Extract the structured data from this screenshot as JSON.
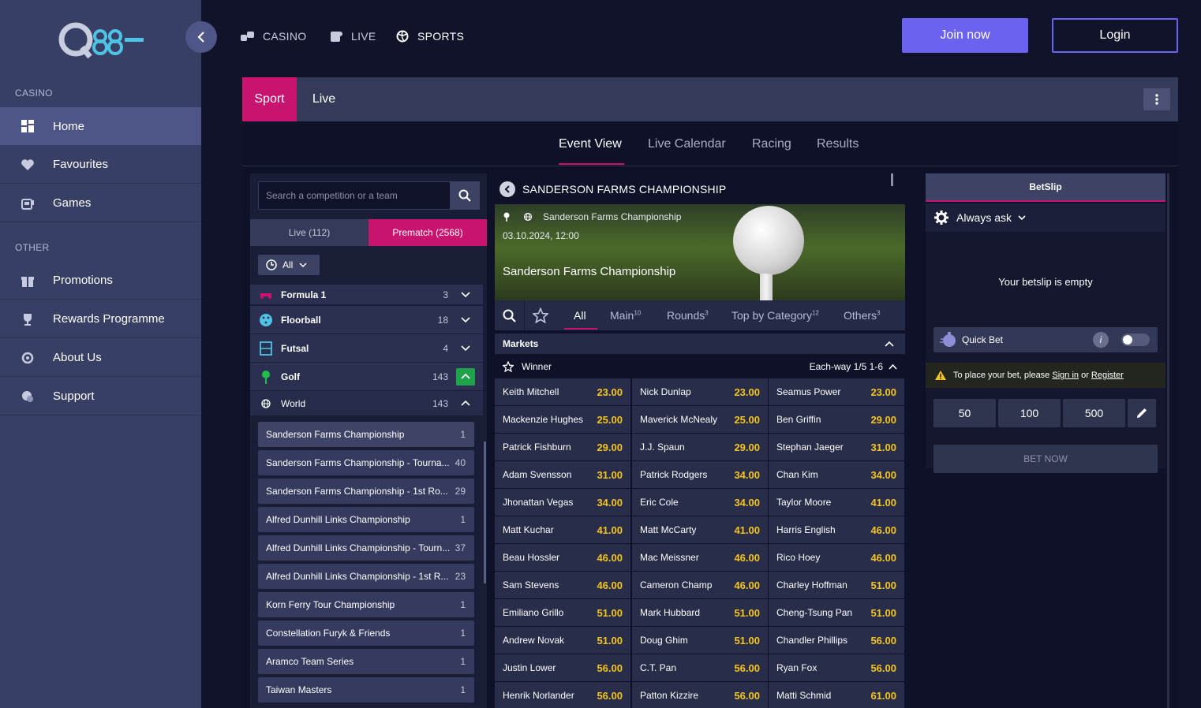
{
  "sidebar": {
    "section_casino": "CASINO",
    "section_other": "OTHER",
    "items": [
      {
        "label": "Home",
        "icon": "grid-icon"
      },
      {
        "label": "Favourites",
        "icon": "heart-icon"
      },
      {
        "label": "Games",
        "icon": "slot-machine-icon"
      },
      {
        "label": "Promotions",
        "icon": "gift-icon"
      },
      {
        "label": "Rewards Programme",
        "icon": "trophy-icon"
      },
      {
        "label": "About Us",
        "icon": "info-circle-icon"
      },
      {
        "label": "Support",
        "icon": "chat-icon"
      }
    ]
  },
  "topnav": {
    "casino": "CASINO",
    "live": "LIVE",
    "sports": "SPORTS"
  },
  "auth": {
    "join": "Join now",
    "login": "Login"
  },
  "modes": {
    "sport": "Sport",
    "live": "Live"
  },
  "view_tabs": [
    "Event View",
    "Live Calendar",
    "Racing",
    "Results"
  ],
  "left_panel": {
    "search_placeholder": "Search a competition or a team",
    "live_tab": "Live (112)",
    "prematch_tab": "Prematch (2568)",
    "filter": "All",
    "sports": [
      {
        "name": "Formula 1",
        "count": "3"
      },
      {
        "name": "Floorball",
        "count": "18"
      },
      {
        "name": "Futsal",
        "count": "4"
      },
      {
        "name": "Golf",
        "count": "143"
      }
    ],
    "region": {
      "name": "World",
      "count": "143"
    },
    "competitions": [
      {
        "name": "Sanderson Farms Championship",
        "count": "1"
      },
      {
        "name": "Sanderson Farms Championship - Tourna...",
        "count": "40"
      },
      {
        "name": "Sanderson Farms Championship - 1st Ro...",
        "count": "29"
      },
      {
        "name": "Alfred Dunhill Links Championship",
        "count": "1"
      },
      {
        "name": "Alfred Dunhill Links Championship - Tourn...",
        "count": "37"
      },
      {
        "name": "Alfred Dunhill Links Championship - 1st R...",
        "count": "23"
      },
      {
        "name": "Korn Ferry Tour Championship",
        "count": "1"
      },
      {
        "name": "Constellation Furyk & Friends",
        "count": "1"
      },
      {
        "name": "Aramco Team Series",
        "count": "1"
      },
      {
        "name": "Taiwan Masters",
        "count": "1"
      }
    ]
  },
  "event": {
    "title": "SANDERSON FARMS CHAMPIONSHIP",
    "league": "Sanderson Farms Championship",
    "datetime": "03.10.2024, 12:00",
    "name": "Sanderson Farms Championship",
    "market_tabs": [
      {
        "label": "All",
        "count": ""
      },
      {
        "label": "Main",
        "count": "10"
      },
      {
        "label": "Rounds",
        "count": "3"
      },
      {
        "label": "Top by Category",
        "count": "12"
      },
      {
        "label": "Others",
        "count": "3"
      }
    ],
    "markets_label": "Markets",
    "winner_label": "Winner",
    "eachway_label": "Each-way 1/5 1-6",
    "odds": [
      [
        "Keith Mitchell",
        "23.00",
        "Nick Dunlap",
        "23.00",
        "Seamus Power",
        "23.00"
      ],
      [
        "Mackenzie Hughes",
        "25.00",
        "Maverick McNealy",
        "25.00",
        "Ben Griffin",
        "29.00"
      ],
      [
        "Patrick Fishburn",
        "29.00",
        "J.J. Spaun",
        "29.00",
        "Stephan Jaeger",
        "31.00"
      ],
      [
        "Adam Svensson",
        "31.00",
        "Patrick Rodgers",
        "34.00",
        "Chan Kim",
        "34.00"
      ],
      [
        "Jhonattan Vegas",
        "34.00",
        "Eric Cole",
        "34.00",
        "Taylor Moore",
        "41.00"
      ],
      [
        "Matt Kuchar",
        "41.00",
        "Matt McCarty",
        "41.00",
        "Harris English",
        "46.00"
      ],
      [
        "Beau Hossler",
        "46.00",
        "Mac Meissner",
        "46.00",
        "Rico Hoey",
        "46.00"
      ],
      [
        "Sam Stevens",
        "46.00",
        "Cameron Champ",
        "46.00",
        "Charley Hoffman",
        "51.00"
      ],
      [
        "Emiliano Grillo",
        "51.00",
        "Mark Hubbard",
        "51.00",
        "Cheng-Tsung Pan",
        "51.00"
      ],
      [
        "Andrew Novak",
        "51.00",
        "Doug Ghim",
        "51.00",
        "Chandler Phillips",
        "56.00"
      ],
      [
        "Justin Lower",
        "56.00",
        "C.T. Pan",
        "56.00",
        "Ryan Fox",
        "56.00"
      ],
      [
        "Henrik Norlander",
        "56.00",
        "Patton Kizzire",
        "56.00",
        "Matti Schmid",
        "61.00"
      ]
    ]
  },
  "betslip": {
    "tab": "BetSlip",
    "ask": "Always ask",
    "empty": "Your betslip is empty",
    "quick_bet": "Quick Bet",
    "warn_pre": "To place your bet, please",
    "sign_in": "Sign in",
    "or": "or",
    "register": "Register",
    "stakes": [
      "50",
      "100",
      "500"
    ],
    "bet_now": "BET NOW"
  },
  "colors": {
    "accent": "#c8136f",
    "brand": "#6b62f0",
    "odds": "#f5c420"
  }
}
